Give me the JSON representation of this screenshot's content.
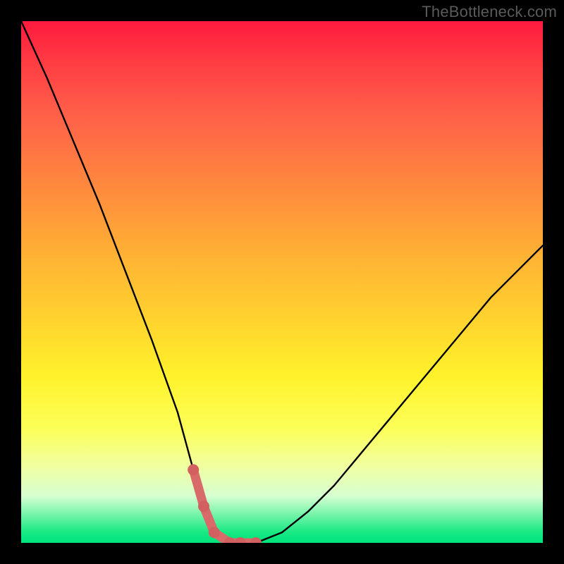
{
  "watermark": "TheBottleneck.com",
  "colors": {
    "background": "#000000",
    "curve": "#000000",
    "highlight": "#d96a6a",
    "highlight_dot": "#d26060",
    "gradient_top": "#ff1a3d",
    "gradient_bottom": "#00e37b"
  },
  "chart_data": {
    "type": "line",
    "title": "",
    "xlabel": "",
    "ylabel": "",
    "xlim": [
      0,
      100
    ],
    "ylim": [
      0,
      100
    ],
    "grid": false,
    "legend": false,
    "series": [
      {
        "name": "bottleneck-curve",
        "x": [
          0,
          5,
          10,
          15,
          20,
          25,
          30,
          33,
          35,
          37,
          40,
          42,
          45,
          50,
          55,
          60,
          65,
          70,
          75,
          80,
          85,
          90,
          95,
          100
        ],
        "values": [
          100,
          89,
          77,
          65,
          52,
          39,
          25,
          14,
          7,
          2,
          0,
          0,
          0,
          2,
          6,
          11,
          17,
          23,
          29,
          35,
          41,
          47,
          52,
          57
        ]
      }
    ],
    "highlight": {
      "x": [
        33,
        35,
        37,
        40,
        42,
        45
      ],
      "values": [
        14,
        7,
        2,
        0,
        0,
        0
      ]
    },
    "annotations": []
  }
}
